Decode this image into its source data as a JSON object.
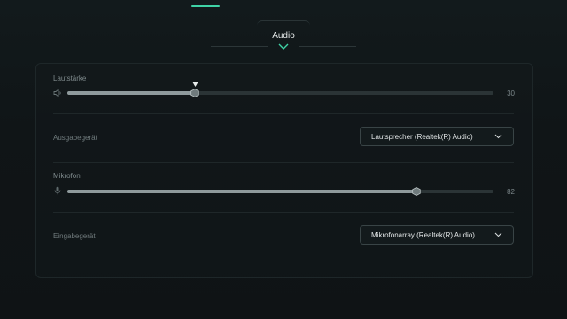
{
  "header": {
    "tab_label": "Audio"
  },
  "volume": {
    "label": "Lautstärke",
    "value": 30,
    "value_text": "30",
    "fraction": 0.3
  },
  "output_device": {
    "label": "Ausgabegerät",
    "selected": "Lautsprecher (Realtek(R) Audio)"
  },
  "microphone": {
    "label": "Mikrofon",
    "value": 82,
    "value_text": "82",
    "fraction": 0.82
  },
  "input_device": {
    "label": "Eingabegerät",
    "selected": "Mikrofonarray (Realtek(R) Audio)"
  },
  "colors": {
    "accent": "#3fd3a6",
    "track": "#2b3436",
    "fill": "#8f9a9c"
  },
  "icons": {
    "volume": "speaker-icon",
    "microphone": "microphone-icon",
    "dropdown": "chevron-down-icon",
    "tab_indicator": "caret-down-icon"
  }
}
